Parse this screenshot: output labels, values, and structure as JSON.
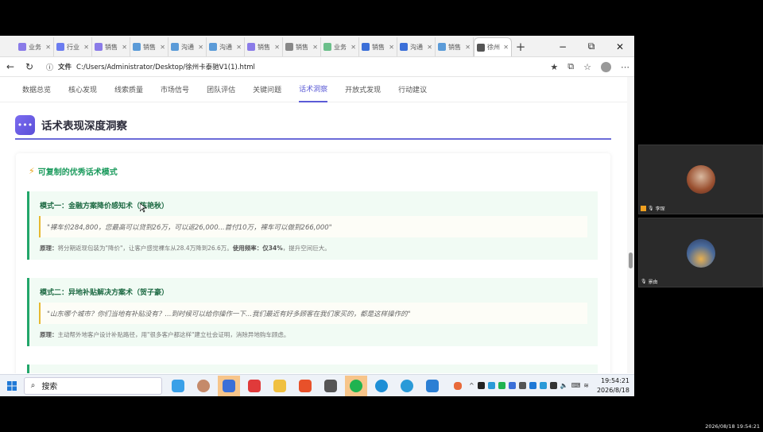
{
  "tabs": [
    {
      "label": "业务",
      "color": "#8a7be8"
    },
    {
      "label": "行业",
      "color": "#6b7cf0"
    },
    {
      "label": "销售",
      "color": "#8a7be8"
    },
    {
      "label": "销售",
      "color": "#5b9bd8"
    },
    {
      "label": "沟通",
      "color": "#5b9bd8"
    },
    {
      "label": "沟通",
      "color": "#5b9bd8"
    },
    {
      "label": "销售",
      "color": "#8a7be8"
    },
    {
      "label": "销售",
      "color": "#888888"
    },
    {
      "label": "业务",
      "color": "#6bbf8a"
    },
    {
      "label": "销售",
      "color": "#3b6fd8"
    },
    {
      "label": "沟通",
      "color": "#3b6fd8"
    },
    {
      "label": "销售",
      "color": "#5b9bd8"
    },
    {
      "label": "徐州",
      "color": "#555555",
      "active": true
    }
  ],
  "window": {
    "minimize": "−",
    "maximize": "⧉",
    "close": "✕"
  },
  "toolbar": {
    "back": "←",
    "reload": "↻",
    "file_label": "文件",
    "url": "C:/Users/Administrator/Desktop/徐州卡泰驰V1(1).html"
  },
  "subnav": [
    "数据总览",
    "核心发现",
    "线索质量",
    "市场信号",
    "团队评估",
    "关键问题",
    "话术洞察",
    "开放式发现",
    "行动建议"
  ],
  "subnav_active": 6,
  "section": {
    "title": "话术表现深度洞察"
  },
  "card": {
    "title": "可复制的优秀话术模式"
  },
  "patterns": [
    {
      "title": "模式一：金融方案降价感知术（陈艳秋）",
      "quote": "\"裸车价284,800，您最高可以贷到26万，可以返26,000...首付10万，裸车可以做到266,000\"",
      "desc_label": "原理：",
      "desc": "将分期返现包装为\"降价\"，让客户感觉裸车从28.4万降到26.6万。",
      "freq_label": "使用频率：",
      "freq": "仅34%",
      "desc_tail": "，提升空间巨大。"
    },
    {
      "title": "模式二：异地补贴解决方案术（贺子豪）",
      "quote": "\"山东哪个城市？你们当地有补贴没有？...到时候可以给你操作一下...我们最近有好多顾客在我们家买的，都是这样操作的\"",
      "desc_label": "原理：",
      "desc": "主动帮外地客户设计补贴路径，用\"很多客户都这样\"建立社会证明，消除异地购车顾虑。"
    }
  ],
  "taskbar": {
    "search": "搜索",
    "time": "19:54:21",
    "date": "2026/8/18"
  },
  "video": [
    {
      "name": "李琛"
    },
    {
      "name": "景由"
    }
  ],
  "stamp": "2026/08/18 19:54:21"
}
